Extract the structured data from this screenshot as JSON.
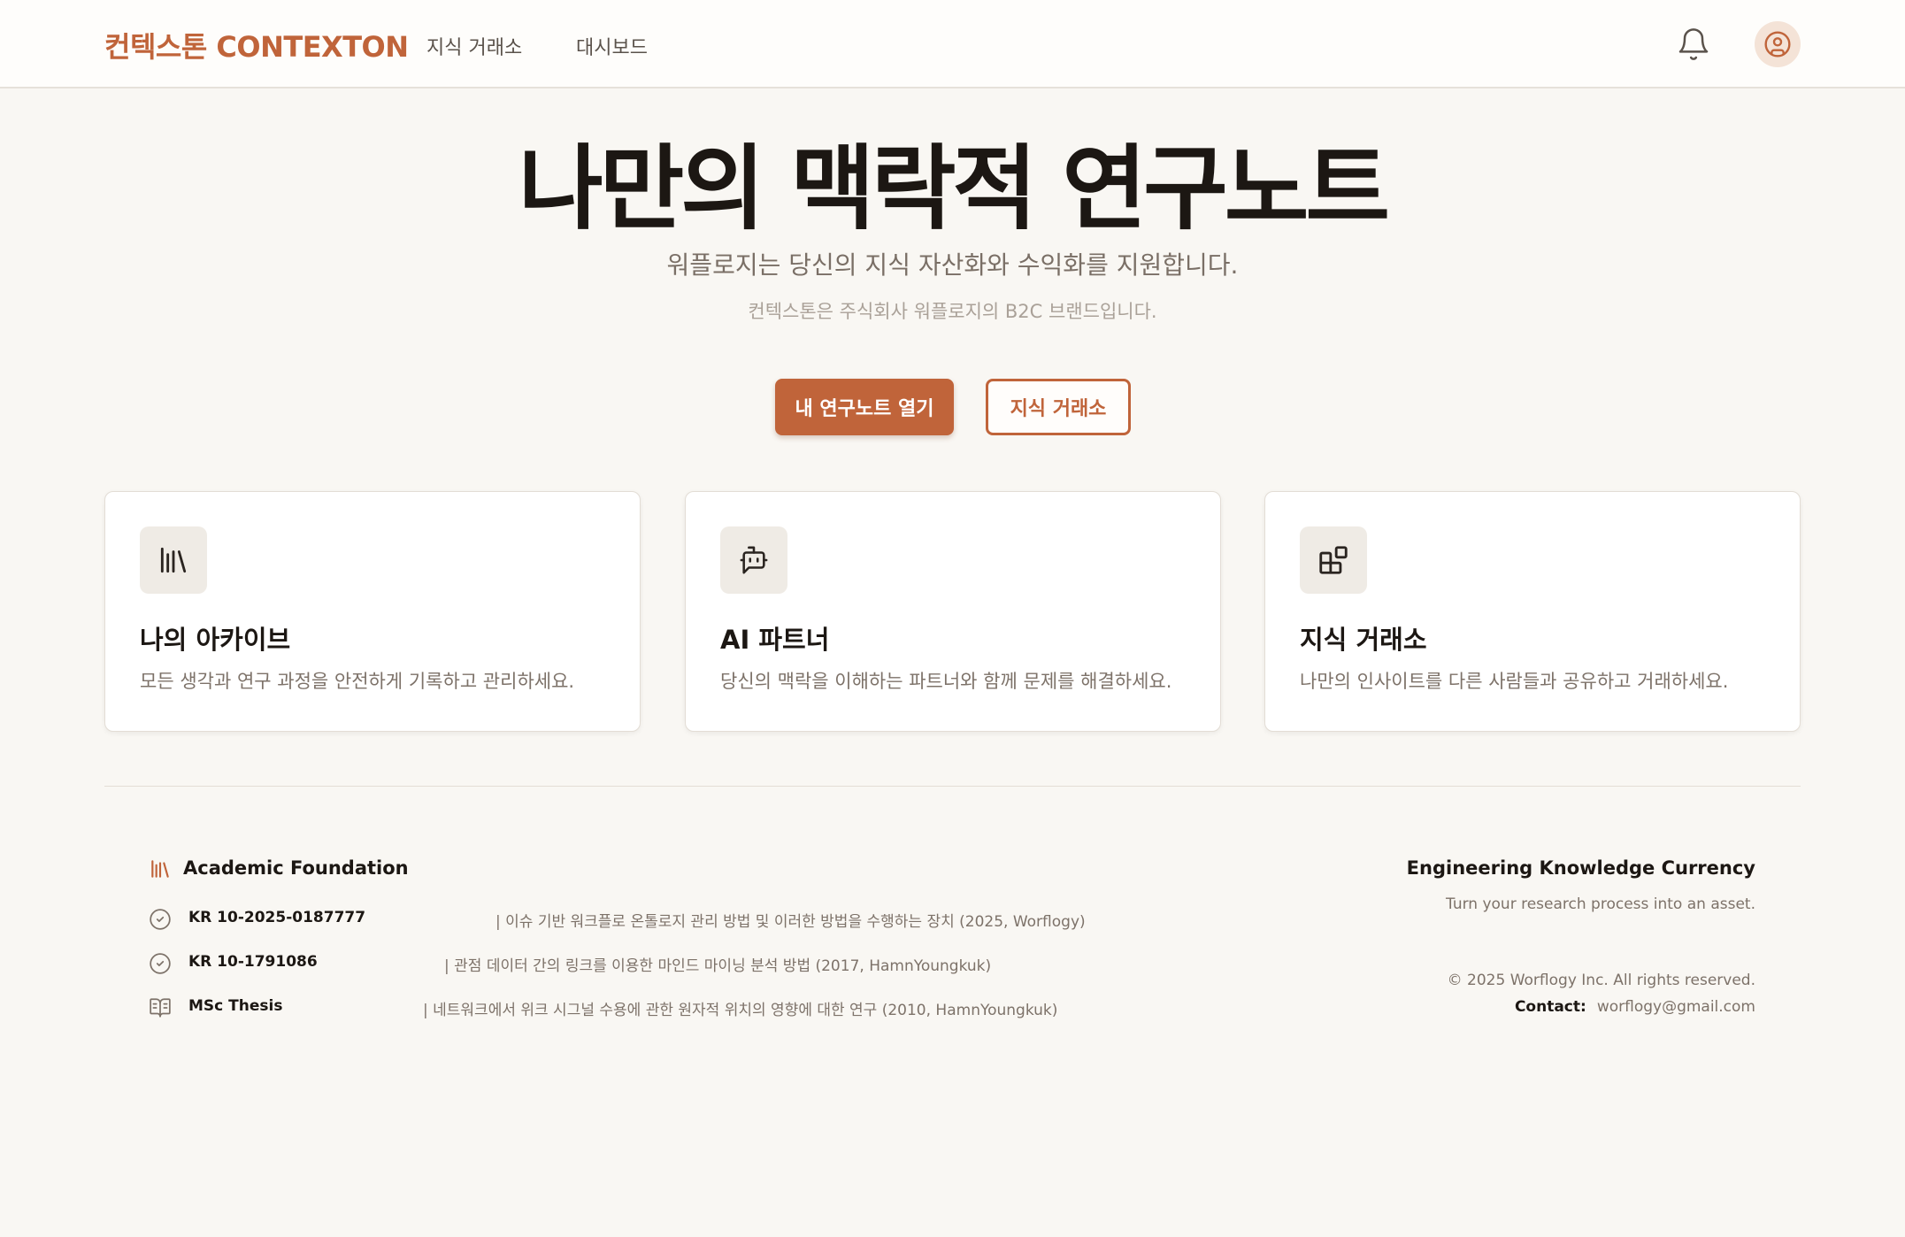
{
  "header": {
    "brand": "컨텍스톤 CONTEXTON",
    "nav": [
      "지식 거래소",
      "대시보드"
    ],
    "icons": [
      "bell-icon",
      "user-circle-icon"
    ]
  },
  "hero": {
    "title": "나만의 맥락적 연구노트",
    "subtitle": "워플로지는 당신의 지식 자산화와 수익화를 지원합니다.",
    "note": "컨텍스톤은 주식회사 워플로지의 B2C 브랜드입니다.",
    "primary_button": "내 연구노트 열기",
    "secondary_button": "지식 거래소"
  },
  "cards": [
    {
      "icon": "library-icon",
      "title": "나의 아카이브",
      "description": "모든 생각과 연구 과정을 안전하게 기록하고 관리하세요."
    },
    {
      "icon": "bot-icon",
      "title": "AI 파트너",
      "description": "당신의 맥락을 이해하는 파트너와 함께 문제를 해결하세요."
    },
    {
      "icon": "blocks-icon",
      "title": "지식 거래소",
      "description": "나만의 인사이트를 다른 사람들과 공유하고 거래하세요."
    }
  ],
  "footer": {
    "foundation_title": "Academic Foundation",
    "items": [
      {
        "icon": "check-circle-icon",
        "code": "KR 10-2025-0187777",
        "detail": "| 이슈 기반 워크플로 온톨로지 관리 방법 및 이러한 방법을 수행하는 장치 (2025, Worflogy)"
      },
      {
        "icon": "check-circle-icon",
        "code": "KR 10-1791086",
        "detail": "| 관점 데이터 간의 링크를 이용한 마인드 마이닝 분석 방법 (2017, HamnYoungkuk)"
      },
      {
        "icon": "book-open-icon",
        "code": "MSc Thesis",
        "detail": "| 네트워크에서 위크 시그널 수용에 관한 원자적 위치의 영향에 대한 연구 (2010, HamnYoungkuk)"
      }
    ],
    "right_title": "Engineering Knowledge Currency",
    "tagline": "Turn your research process into an asset.",
    "copyright": "© 2025 Worflogy Inc. All rights reserved.",
    "contact_label": "Contact:",
    "contact_email": "worflogy@gmail.com"
  },
  "colors": {
    "accent": "#c0643a",
    "background": "#f9f7f3",
    "text": "#1c1713",
    "muted": "#7d7269"
  }
}
